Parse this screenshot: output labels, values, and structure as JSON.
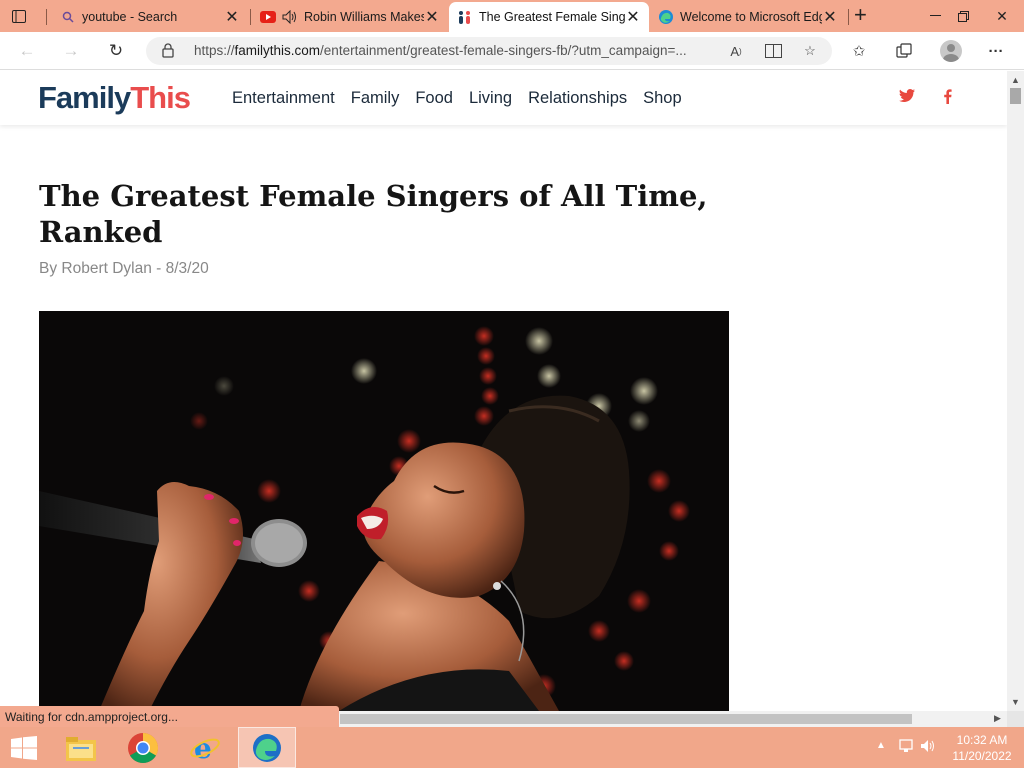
{
  "browser": {
    "tabs": [
      {
        "title": "youtube - Search",
        "icon": "search-icon"
      },
      {
        "title": "Robin Williams Makes",
        "icon": "youtube-icon",
        "audio": "speaker-icon"
      },
      {
        "title": "The Greatest Female Singers",
        "icon": "familythis-icon",
        "active": true
      },
      {
        "title": "Welcome to Microsoft Edge",
        "icon": "edge-icon"
      }
    ],
    "url_prefix": "https://",
    "url_host": "familythis.com",
    "url_path": "/entertainment/greatest-female-singers-fb/?utm_campaign=..."
  },
  "site": {
    "logo_part1": "Family",
    "logo_part2": "This",
    "nav": [
      "Entertainment",
      "Family",
      "Food",
      "Living",
      "Relationships",
      "Shop"
    ],
    "social_twitter": "t",
    "social_facebook": "f"
  },
  "article": {
    "title": "The Greatest Female Singers of All Time, Ranked",
    "byline": "By Robert Dylan - 8/3/20",
    "hero_alt": "Singer with microphone"
  },
  "status_text": "Waiting for cdn.ampproject.org...",
  "taskbar": {
    "time": "10:32 AM",
    "date": "11/20/2022"
  },
  "colors": {
    "chrome_accent": "#f3a98f",
    "logo_dark": "#1b3b5a",
    "logo_red": "#e94d4d"
  }
}
